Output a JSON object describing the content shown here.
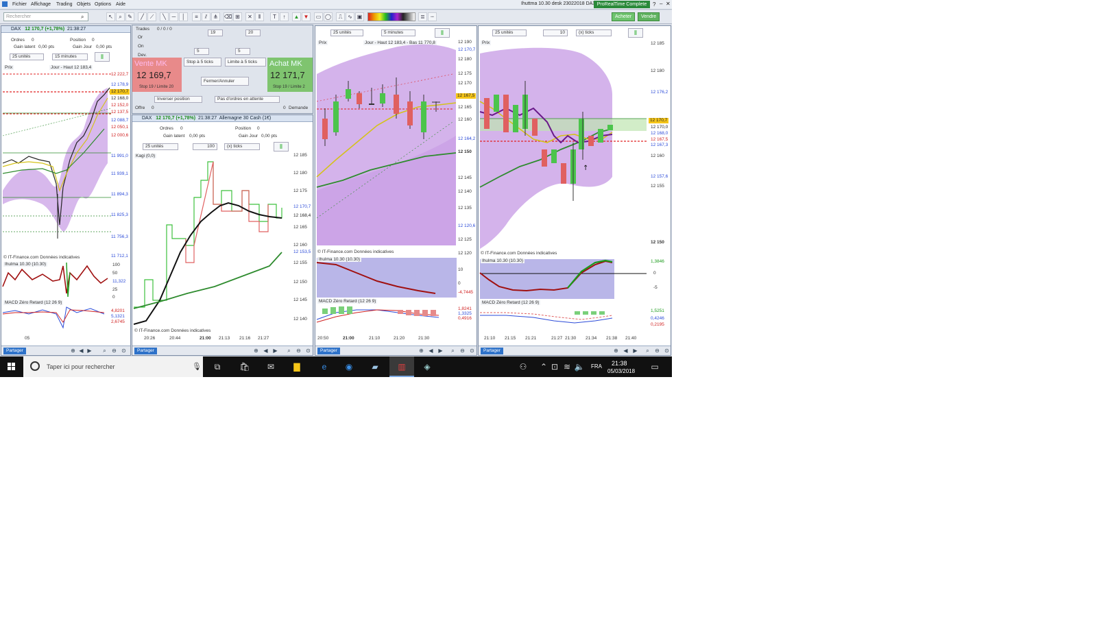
{
  "menubar": {
    "items": [
      "Fichier",
      "Affichage",
      "Trading",
      "Objets",
      "Options",
      "Aide"
    ],
    "window_title": "Ihuttma 10.30 desk 23022018 DAX",
    "edition": "ProRealTime Complete"
  },
  "toolbar": {
    "search_placeholder": "Rechercher",
    "buy_label": "Acheter",
    "sell_label": "Vendre"
  },
  "chart1": {
    "symbol": "DAX",
    "quote": "12 170,7 (+1,78%)",
    "time": "21:38:27",
    "orders_label": "Ordres",
    "orders_value": "0",
    "position_label": "Position",
    "position_value": "0",
    "gain_latent_label": "Gain latent",
    "gain_latent_value": "0,00 pts",
    "gain_jour_label": "Gain Jour",
    "gain_jour_value": "0,00 pts",
    "units": "25 unités",
    "period": "15 minutes",
    "legend": "Prix",
    "info": "Jour - Haut 12 183,4",
    "attribution": "© IT-Finance.com Données indicatives",
    "ind1": "Ihulma 10.30 (10.30)",
    "ind2": "MACD Zéro Retard (12 26 9)",
    "price_axis": [
      "12 222,7",
      "12 178,9",
      "12 170,7",
      "12 168,0",
      "12 152,0",
      "12 137,5",
      "12 088,7",
      "12 050,1",
      "12 000,6",
      "11 991,0",
      "11 939,1",
      "11 894,3",
      "11 825,3",
      "11 756,3",
      "11 712,1"
    ],
    "ind1_axis": [
      "100",
      "50",
      "11,322",
      "25",
      "0"
    ],
    "ind2_axis": [
      "4,8201",
      "5,1321",
      "2,6745"
    ],
    "date_label": "05"
  },
  "order": {
    "trades_label": "Trades",
    "trades_value": "0 / 0 / 0",
    "or_label": "Or",
    "on_label": "On",
    "dev_label": "Dev.",
    "qty1": "19",
    "qty2": "20",
    "qty3": "5",
    "qty4": "5",
    "stop_label": "Stop à 5 ticks",
    "limit_label": "Limite à 5 ticks",
    "sell_title": "Vente MK",
    "sell_price": "12 169,7",
    "sell_stop": "Stop 19 / Limite 20",
    "buy_title": "Achat MK",
    "buy_price": "12 171,7",
    "buy_stop": "Stop 19 / Limite 2",
    "cancel_label": "Fermer/Annuler",
    "reverse_label": "Inverser position",
    "noorders_label": "Pas d'ordres en attente",
    "offre_label": "Offre",
    "offre_value": "0",
    "demande_label": "Demande",
    "demande_value": "0"
  },
  "chart2": {
    "symbol": "DAX",
    "quote": "12 170,7 (+1,78%)",
    "time": "21:38:27",
    "desc": "Allemagne 30 Cash (1€)",
    "ordres_label": "Ordres",
    "ordres_value": "0",
    "position_label": "Position",
    "position_value": "0",
    "gain_latent_label": "Gain latent",
    "gain_latent_value": "0,00 pts",
    "gain_jour_label": "Gain Jour",
    "gain_jour_value": "0,00 pts",
    "units": "25 unités",
    "ticks_value": "100",
    "ticks_label": "(x) ticks",
    "legend": "Kagi (0,0)",
    "attribution": "© IT-Finance.com Données indicatives",
    "price_axis": [
      "12 185",
      "12 180",
      "12 175",
      "12 170",
      "12 165",
      "12 160",
      "12 155",
      "12 150",
      "12 145",
      "12 140"
    ],
    "price_box1": "12 170,7",
    "price_box2": "12 168,4",
    "price_box3": "12 153,5",
    "time_axis": [
      "20:26",
      "20:44",
      "21:00",
      "21:13",
      "21:16",
      "21:27"
    ]
  },
  "chart3": {
    "units": "25 unités",
    "period": "5 minutes",
    "legend": "Prix",
    "info": "Jour - Haut 12 183,4 - Bas 11 770,8",
    "attribution": "© IT-Finance.com Données indicatives",
    "ind1": "Ihulma 10.30 (10.30)",
    "ind2": "MACD Zéro Retard (12 26 9)",
    "price_axis": [
      "12 190",
      "12 185",
      "12 180",
      "12 175",
      "12 170",
      "12 165",
      "12 160",
      "12 155",
      "12 150",
      "12 145",
      "12 140",
      "12 135",
      "12 130",
      "12 125",
      "12 120"
    ],
    "price_box1": "12 170,7",
    "price_box2": "12 167,5",
    "price_box3": "12 164,2",
    "price_box4": "12 120,6",
    "ind1_axis": [
      "10",
      "0",
      "-4,7445"
    ],
    "ind2_axis": [
      "1,8241",
      "1,3325",
      "0,4916"
    ],
    "time_axis": [
      "20:50",
      "21:00",
      "21:10",
      "21:20",
      "21:30"
    ]
  },
  "chart4": {
    "units": "25 unités",
    "ticks_value": "10",
    "ticks_label": "(x) ticks",
    "legend": "Prix",
    "attribution": "© IT-Finance.com Données indicatives",
    "ind1": "Ihulma 10.30 (10.30)",
    "ind2": "MACD Zéro Retard (12 26 9)",
    "price_axis": [
      "12 185",
      "12 180",
      "12 175",
      "12 170",
      "12 165",
      "12 160",
      "12 155",
      "12 150"
    ],
    "price_box1": "12 176,2",
    "price_box2": "12 170,7",
    "price_box3": "12 170,0",
    "price_box4": "12 168,0",
    "price_box5": "12 167,5",
    "price_box6": "12 167,3",
    "price_box7": "12 157,6",
    "ind1_axis": [
      "1,3846",
      "0",
      "-5"
    ],
    "ind2_axis": [
      "1,5251",
      "0,4246",
      "0,2195"
    ],
    "time_axis": [
      "21:10",
      "21:15",
      "21:21",
      "21:27",
      "21:30",
      "21:34",
      "21:38",
      "21:40"
    ]
  },
  "footer": {
    "share_label": "Partager"
  },
  "taskbar": {
    "search_placeholder": "Taper ici pour rechercher",
    "lang": "FRA",
    "time": "21:38",
    "date": "05/03/2018"
  },
  "colors": {
    "bollinger_fill": "#c9a0e6",
    "up_candle": "#4cc44c",
    "down_candle": "#e06060",
    "avg_yellow": "#d4c21a",
    "avg_green": "#2e8b2e",
    "resistance": "#e02020"
  }
}
